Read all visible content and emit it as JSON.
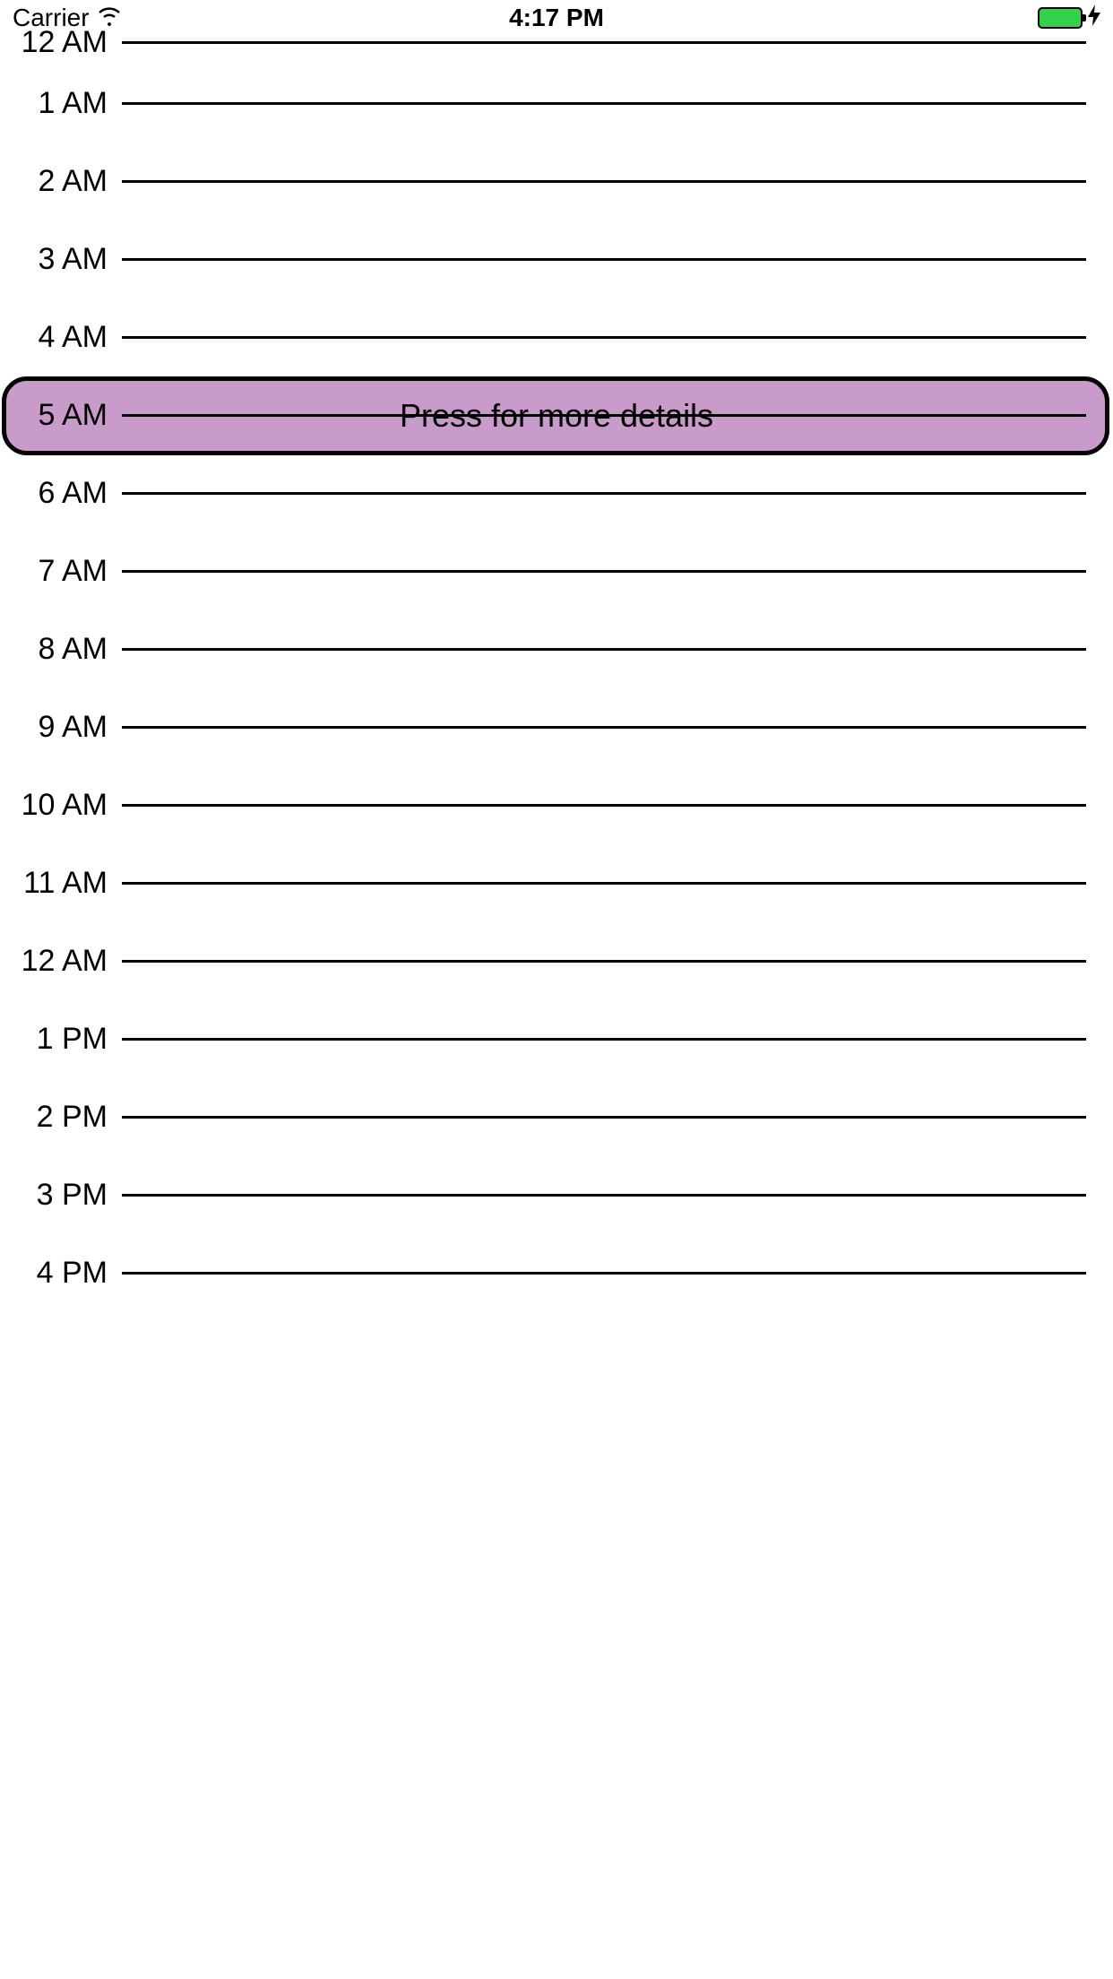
{
  "status_bar": {
    "carrier": "Carrier",
    "time": "4:17 PM"
  },
  "hours": [
    {
      "label": "12 AM"
    },
    {
      "label": "1 AM"
    },
    {
      "label": "2 AM"
    },
    {
      "label": "3 AM"
    },
    {
      "label": "4 AM"
    },
    {
      "label": "5 AM"
    },
    {
      "label": "6 AM"
    },
    {
      "label": "7 AM"
    },
    {
      "label": "8 AM"
    },
    {
      "label": "9 AM"
    },
    {
      "label": "10 AM"
    },
    {
      "label": "11 AM"
    },
    {
      "label": "12 AM"
    },
    {
      "label": "1 PM"
    },
    {
      "label": "2 PM"
    },
    {
      "label": "3 PM"
    },
    {
      "label": "4 PM"
    }
  ],
  "event": {
    "label": "Press for more details",
    "hour_index": 5
  }
}
